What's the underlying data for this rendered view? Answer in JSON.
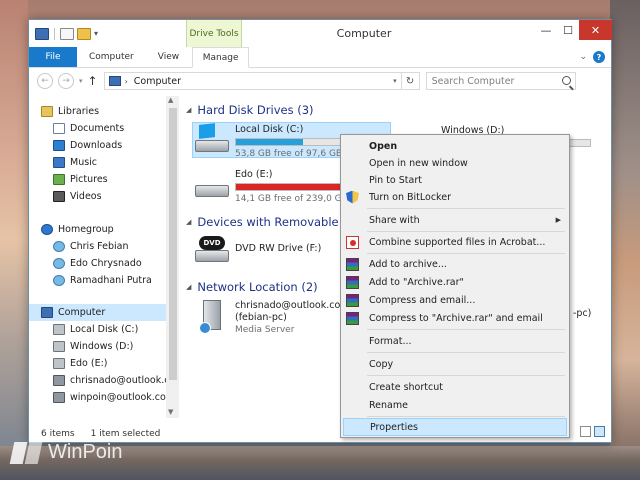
{
  "window": {
    "title": "Computer",
    "context_tab_group": "Drive Tools"
  },
  "ribbon": {
    "tabs": [
      "File",
      "Computer",
      "View",
      "Manage"
    ]
  },
  "address": {
    "path": "Computer",
    "search_placeholder": "Search Computer"
  },
  "navpane": {
    "libraries": "Libraries",
    "documents": "Documents",
    "downloads": "Downloads",
    "music": "Music",
    "pictures": "Pictures",
    "videos": "Videos",
    "homegroup": "Homegroup",
    "user1": "Chris Febian",
    "user2": "Edo Chrysnado",
    "user3": "Ramadhani Putra",
    "computer": "Computer",
    "drive_c": "Local Disk (C:)",
    "drive_d": "Windows (D:)",
    "drive_e": "Edo (E:)",
    "net1": "chrisnado@outlook.co",
    "net2": "winpoin@outlook.com"
  },
  "groups": {
    "hdd": "Hard Disk Drives (3)",
    "removable": "Devices with Removable St",
    "network": "Network Location (2)"
  },
  "drives": {
    "c_name": "Local Disk (C:)",
    "c_free": "53,8 GB free of 97,6 GB",
    "c_usage": 0.45,
    "d_name": "Windows (D:)",
    "e_name": "Edo (E:)",
    "e_free": "14,1 GB free of 239,0 GB",
    "e_usage": 0.94,
    "dvd_name": "DVD RW Drive (F:)",
    "net_name": "chrisnado@outlook.com",
    "net_sub": "(febian-pc)",
    "net_type": "Media Server",
    "net2_tail": "-pc)"
  },
  "colors": {
    "bar_normal": "#26a0da",
    "bar_full": "#da2626",
    "accent": "#1979ca"
  },
  "status": {
    "count": "6 items",
    "selection": "1 item selected"
  },
  "context_menu": {
    "open": "Open",
    "open_new_window": "Open in new window",
    "pin_start": "Pin to Start",
    "bitlocker": "Turn on BitLocker",
    "share_with": "Share with",
    "combine_acrobat": "Combine supported files in Acrobat...",
    "add_archive": "Add to archive...",
    "add_archive_rar": "Add to \"Archive.rar\"",
    "compress_email": "Compress and email...",
    "compress_rar_email": "Compress to \"Archive.rar\" and email",
    "format": "Format...",
    "copy": "Copy",
    "create_shortcut": "Create shortcut",
    "rename": "Rename",
    "properties": "Properties"
  },
  "watermark": "WinPoin"
}
